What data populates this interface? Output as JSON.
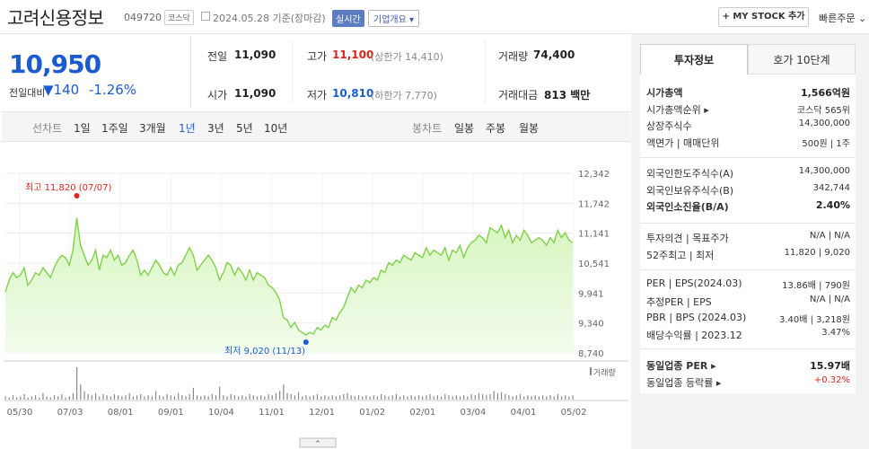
{
  "header": {
    "stock_name": "고려신용정보",
    "stock_code": "049720",
    "market": "코스닥",
    "date_text": "2024.05.28 기준(장마감)",
    "realtime_label": "실시간",
    "corp_overview_label": "기업개요 ▾",
    "my_stock_label": "+ MY STOCK 추가",
    "quick_order_label": "빠른주문 ⌄"
  },
  "quote": {
    "price": "10,950",
    "change_label": "전일대비",
    "change_value": "▼140",
    "change_pct": "-1.26%",
    "prev_close_label": "전일",
    "prev_close": "11,090",
    "high_label": "고가",
    "high": "11,100",
    "upper_limit": "(상한가 14,410)",
    "volume_label": "거래량",
    "volume": "74,400",
    "open_label": "시가",
    "open": "11,090",
    "low_label": "저가",
    "low": "10,810",
    "lower_limit": "(하한가 7,770)",
    "amount_label": "거래대금",
    "amount": "813 백만"
  },
  "periods": {
    "line_label": "선차트",
    "line": [
      "1일",
      "1주일",
      "3개월",
      "1년",
      "3년",
      "5년",
      "10년"
    ],
    "candle_label": "봉차트",
    "candle": [
      "일봉",
      "주봉",
      "월봉"
    ]
  },
  "chart_data": {
    "type": "area",
    "y_ticks": [
      "12,342",
      "11,742",
      "11,141",
      "10,541",
      "9,941",
      "9,340",
      "8,740"
    ],
    "ylim": [
      8740,
      12342
    ],
    "x_ticks": [
      "05/30",
      "07/03",
      "08/01",
      "09/01",
      "10/04",
      "11/01",
      "12/01",
      "01/02",
      "02/01",
      "03/04",
      "04/01",
      "05/02"
    ],
    "max_annotation": "최고 11,820 (07/07)",
    "min_annotation": "최저 9,020 (11/13)",
    "volume_label": "거래량",
    "colors": {
      "line": "#7fd14a",
      "fill_top": "#d6f5bf",
      "fill_bottom": "#f3fcec",
      "max": "#e2231a",
      "min": "#1a5bd0",
      "volume": "#888888"
    },
    "values": [
      9960,
      10200,
      10350,
      10250,
      10300,
      10450,
      10100,
      10200,
      10350,
      10300,
      10450,
      10350,
      10250,
      10450,
      10600,
      10700,
      10650,
      10500,
      10800,
      11450,
      10900,
      10700,
      10500,
      10600,
      10800,
      10400,
      10700,
      10650,
      10800,
      10600,
      10700,
      10500,
      10550,
      10700,
      10800,
      10600,
      10300,
      10400,
      10300,
      10450,
      10600,
      10500,
      10350,
      10300,
      10450,
      10300,
      10500,
      10550,
      10700,
      10850,
      10700,
      10400,
      10500,
      10600,
      10700,
      10600,
      10450,
      10200,
      10350,
      10550,
      10500,
      10300,
      10450,
      10350,
      10200,
      10400,
      10200,
      10350,
      10300,
      10250,
      10100,
      10050,
      9950,
      9800,
      9450,
      9400,
      9250,
      9350,
      9200,
      9150,
      9100,
      9150,
      9120,
      9250,
      9200,
      9300,
      9250,
      9450,
      9400,
      9550,
      9650,
      9850,
      10050,
      9950,
      10100,
      10050,
      10200,
      10150,
      10250,
      10200,
      10400,
      10350,
      10550,
      10500,
      10600,
      10550,
      10700,
      10650,
      10600,
      10750,
      10700,
      10650,
      10850,
      10700,
      10800,
      10750,
      10700,
      10850,
      10600,
      10800,
      10750,
      10900,
      10650,
      10850,
      10950,
      11000,
      11100,
      11050,
      10950,
      11250,
      11200,
      11150,
      11300,
      11050,
      11200,
      10950,
      11100,
      11000,
      11200,
      11100,
      10950,
      11000,
      11050,
      11000,
      10900,
      11050,
      10950,
      11200,
      11050,
      11150,
      11000,
      10950
    ],
    "volumes": [
      3,
      2,
      4,
      2,
      3,
      5,
      2,
      3,
      4,
      2,
      6,
      3,
      2,
      4,
      3,
      5,
      2,
      3,
      6,
      30,
      14,
      8,
      5,
      4,
      6,
      3,
      5,
      4,
      3,
      5,
      4,
      3,
      4,
      6,
      3,
      4,
      5,
      3,
      4,
      3,
      8,
      4,
      3,
      5,
      4,
      3,
      6,
      4,
      3,
      5,
      11,
      4,
      3,
      4,
      3,
      5,
      4,
      12,
      4,
      3,
      5,
      4,
      3,
      4,
      3,
      5,
      4,
      3,
      4,
      3,
      5,
      4,
      6,
      8,
      14,
      6,
      5,
      4,
      7,
      3,
      4,
      3,
      4,
      5,
      3,
      4,
      3,
      4,
      3,
      4,
      5,
      6,
      4,
      3,
      4,
      3,
      4,
      3,
      4,
      3,
      5,
      4,
      3,
      4,
      5,
      3,
      4,
      3,
      4,
      3,
      4,
      3,
      4,
      5,
      3,
      4,
      3,
      5,
      4,
      3,
      4,
      3,
      4,
      3,
      5,
      4,
      6,
      5,
      4,
      5,
      8,
      6,
      7,
      5,
      4,
      3,
      4,
      5,
      3,
      4,
      3,
      4,
      3,
      4,
      3,
      4,
      3,
      5,
      3,
      4,
      3,
      4
    ]
  },
  "invest_info": {
    "tab_active": "투자정보",
    "tab_other": "호가 10단계",
    "rows1": [
      {
        "label": "시가총액",
        "value": "1,566억원",
        "bold": true
      },
      {
        "label": "시가총액순위 ▸",
        "value": "코스닥 565위"
      },
      {
        "label": "상장주식수",
        "value": "14,300,000"
      },
      {
        "label": "액면가 | 매매단위",
        "value": "500원 | 1주"
      }
    ],
    "rows2": [
      {
        "label": "외국인한도주식수(A)",
        "value": "14,300,000"
      },
      {
        "label": "외국인보유주식수(B)",
        "value": "342,744"
      },
      {
        "label": "외국인소진율(B/A)",
        "value": "2.40%",
        "bold": true
      }
    ],
    "rows3": [
      {
        "label": "투자의견 | 목표주가",
        "value": "N/A | N/A"
      },
      {
        "label": "52주최고 | 최저",
        "value": "11,820 | 9,020"
      }
    ],
    "rows4": [
      {
        "label": "PER | EPS(2024.03)",
        "value": "13.86배 | 790원"
      },
      {
        "label": "추정PER | EPS",
        "value": "N/A | N/A"
      },
      {
        "label": "PBR | BPS (2024.03)",
        "value": "3.40배 | 3,218원"
      },
      {
        "label": "배당수익률 | 2023.12",
        "value": "3.47%"
      }
    ],
    "rows5": [
      {
        "label": "동일업종 PER ▸",
        "value": "15.97배",
        "bold": true
      },
      {
        "label": "동일업종 등락률 ▸",
        "value": "+0.32%",
        "red": true
      }
    ]
  }
}
